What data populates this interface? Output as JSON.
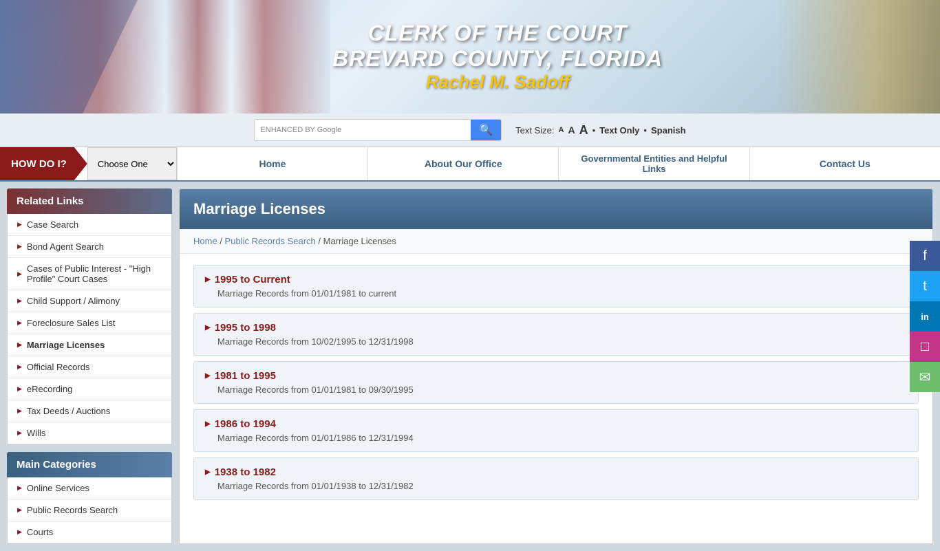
{
  "header": {
    "line1": "CLERK OF THE COURT",
    "line2": "BREVARD COUNTY, FLORIDA",
    "line3": "Rachel M. Sadoff"
  },
  "search": {
    "google_label": "ENHANCED BY Google",
    "placeholder": "",
    "text_size_label": "Text Size:",
    "size_small": "A",
    "size_medium": "A",
    "size_large": "A",
    "text_only": "Text Only",
    "spanish": "Spanish"
  },
  "nav": {
    "how_do_i": "HOW DO I?",
    "choose_one": "Choose One",
    "links": [
      {
        "label": "Home"
      },
      {
        "label": "About Our Office"
      },
      {
        "label": "Governmental Entities and Helpful Links"
      },
      {
        "label": "Contact Us"
      }
    ]
  },
  "sidebar": {
    "related_links_title": "Related Links",
    "related_links": [
      {
        "label": "Case Search"
      },
      {
        "label": "Bond Agent Search"
      },
      {
        "label": "Cases of Public Interest - \"High Profile\" Court Cases"
      },
      {
        "label": "Child Support / Alimony"
      },
      {
        "label": "Foreclosure Sales List"
      },
      {
        "label": "Marriage Licenses"
      },
      {
        "label": "Official Records"
      },
      {
        "label": "eRecording"
      },
      {
        "label": "Tax Deeds / Auctions"
      },
      {
        "label": "Wills"
      }
    ],
    "main_categories_title": "Main Categories",
    "main_categories": [
      {
        "label": "Online Services"
      },
      {
        "label": "Public Records Search"
      },
      {
        "label": "Courts"
      }
    ]
  },
  "content": {
    "title": "Marriage Licenses",
    "breadcrumb": {
      "home": "Home",
      "section": "Public Records Search",
      "current": "Marriage Licenses"
    },
    "records": [
      {
        "title": "1995 to Current",
        "desc": "Marriage Records from 01/01/1981 to current"
      },
      {
        "title": "1995 to 1998",
        "desc": "Marriage Records from 10/02/1995 to 12/31/1998"
      },
      {
        "title": "1981 to 1995",
        "desc": "Marriage Records from 01/01/1981 to 09/30/1995"
      },
      {
        "title": "1986 to 1994",
        "desc": "Marriage Records from 01/01/1986 to 12/31/1994"
      },
      {
        "title": "1938 to 1982",
        "desc": "Marriage Records from 01/01/1938 to 12/31/1982"
      }
    ]
  },
  "social": {
    "facebook_icon": "f",
    "twitter_icon": "t",
    "linkedin_icon": "in",
    "instagram_icon": "ig",
    "email_icon": "✉"
  }
}
